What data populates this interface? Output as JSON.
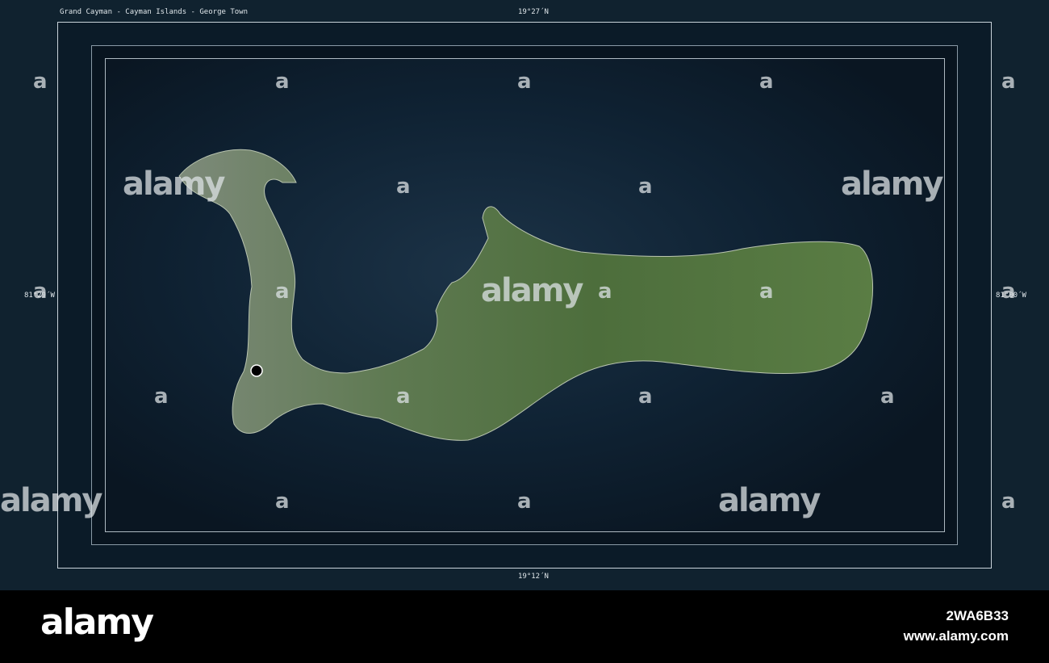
{
  "map": {
    "title": "Grand Cayman - Cayman Islands - George Town",
    "top_latitude": "19°27´N",
    "bottom_latitude": "19°12´N",
    "left_longitude": "81°29´W",
    "right_longitude": "81°00´W",
    "marker_label": "George Town",
    "colors": {
      "frame": "#10222f",
      "sea": "#0f2233",
      "land": "#4d6e3c",
      "marker": "#000000"
    }
  },
  "watermark": {
    "text": "alamy",
    "glyph": "a"
  },
  "footer": {
    "logo": "alamy",
    "image_id": "2WA6B33",
    "website": "www.alamy.com"
  }
}
